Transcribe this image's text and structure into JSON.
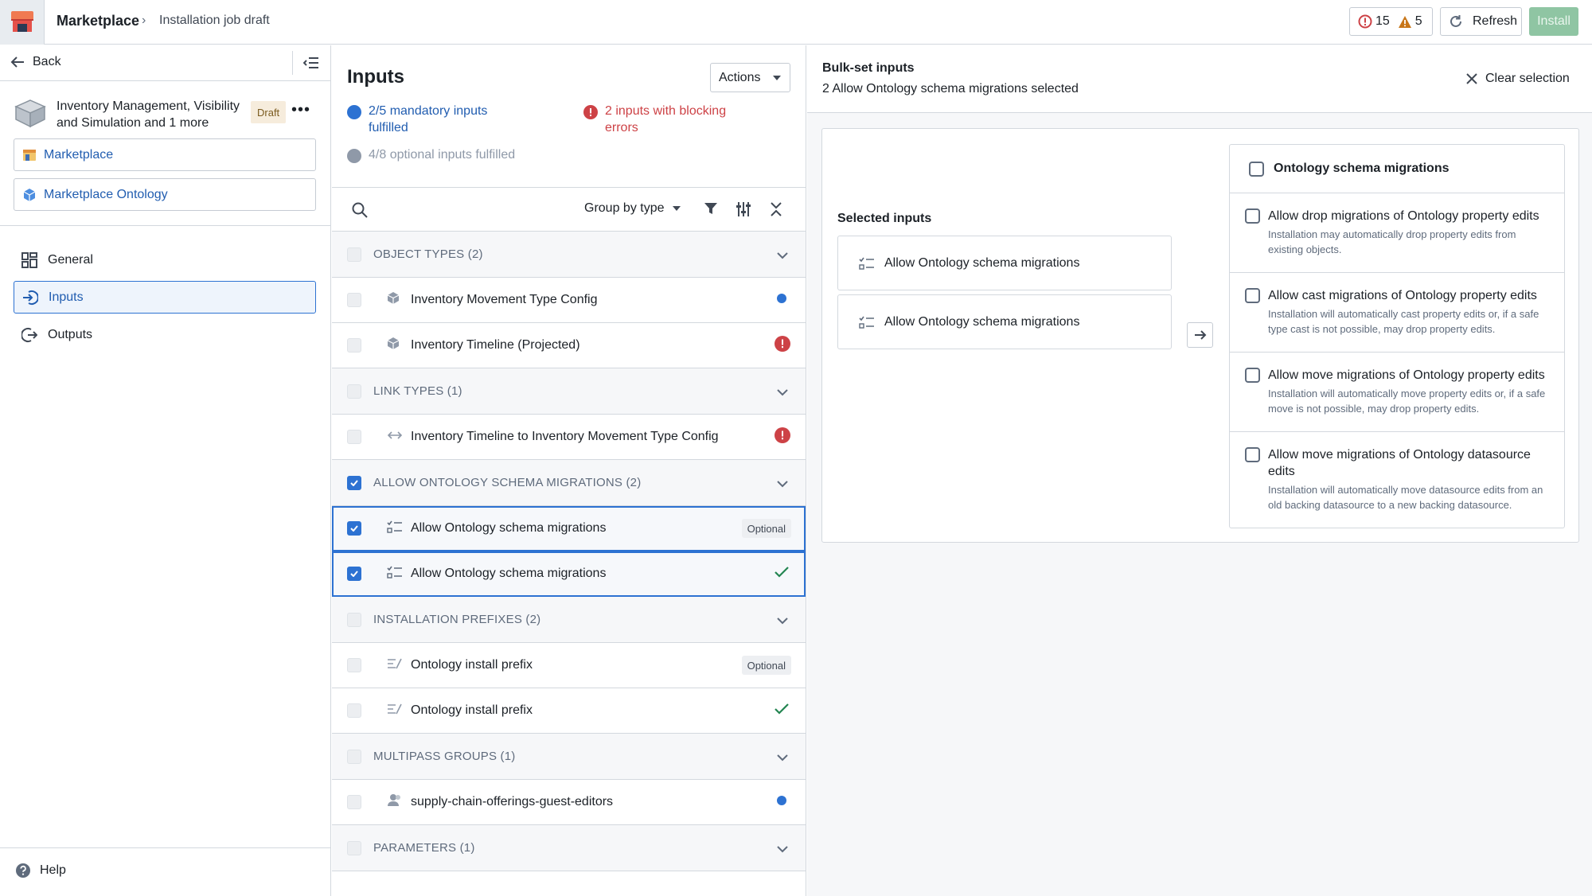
{
  "topbar": {
    "app_name": "Marketplace",
    "breadcrumb_current": "Installation job draft",
    "error_count": "15",
    "warning_count": "5",
    "refresh_label": "Refresh",
    "install_label": "Install"
  },
  "sidebar": {
    "back_label": "Back",
    "product_title": "Inventory Management, Visibility and Simulation and 1 more",
    "draft_badge": "Draft",
    "links": [
      {
        "label": "Marketplace",
        "icon": "marketplace-store-icon"
      },
      {
        "label": "Marketplace Ontology",
        "icon": "ontology-cube-icon"
      }
    ],
    "nav": [
      {
        "label": "General",
        "icon": "dashboard-grid-icon"
      },
      {
        "label": "Inputs",
        "icon": "log-in-icon",
        "active": true
      },
      {
        "label": "Outputs",
        "icon": "log-out-icon"
      }
    ],
    "help_label": "Help"
  },
  "inputs": {
    "title": "Inputs",
    "actions_label": "Actions",
    "mandatory_status": "2/5 mandatory inputs fulfilled",
    "blocking_status": "2 inputs with blocking errors",
    "optional_status": "4/8 optional inputs fulfilled",
    "group_by_label": "Group by type",
    "optional_tag": "Optional",
    "sections": [
      {
        "header": "OBJECT TYPES (2)",
        "checked": false,
        "items": [
          {
            "label": "Inventory Movement Type Config",
            "icon": "cube-icon",
            "status": "blue-dot",
            "checked": false
          },
          {
            "label": "Inventory Timeline (Projected)",
            "icon": "cube-icon",
            "status": "error",
            "checked": false
          }
        ]
      },
      {
        "header": "LINK TYPES (1)",
        "checked": false,
        "items": [
          {
            "label": "Inventory Timeline to Inventory Movement Type Config",
            "icon": "link-arrows-icon",
            "status": "error",
            "checked": false
          }
        ]
      },
      {
        "header": "ALLOW ONTOLOGY SCHEMA MIGRATIONS (2)",
        "checked": true,
        "items": [
          {
            "label": "Allow Ontology schema migrations",
            "icon": "checklist-icon",
            "status": "optional",
            "checked": true,
            "selected": true
          },
          {
            "label": "Allow Ontology schema migrations",
            "icon": "checklist-icon",
            "status": "check",
            "checked": true,
            "selected": true
          }
        ]
      },
      {
        "header": "INSTALLATION PREFIXES (2)",
        "checked": false,
        "items": [
          {
            "label": "Ontology install prefix",
            "icon": "text-prefix-icon",
            "status": "optional",
            "checked": false
          },
          {
            "label": "Ontology install prefix",
            "icon": "text-prefix-icon",
            "status": "check",
            "checked": false
          }
        ]
      },
      {
        "header": "MULTIPASS GROUPS (1)",
        "checked": false,
        "items": [
          {
            "label": "supply-chain-offerings-guest-editors",
            "icon": "people-icon",
            "status": "blue-dot",
            "checked": false
          }
        ]
      },
      {
        "header": "PARAMETERS (1)",
        "checked": false,
        "items": []
      }
    ]
  },
  "bulk": {
    "title": "Bulk-set inputs",
    "subtitle": "2 Allow Ontology schema migrations selected",
    "clear_label": "Clear selection",
    "selected_label": "Selected inputs",
    "selected_items": [
      "Allow Ontology schema migrations",
      "Allow Ontology schema migrations"
    ],
    "options_header": "Ontology schema migrations",
    "options": [
      {
        "title": "Allow drop migrations of Ontology property edits",
        "desc": "Installation may automatically drop property edits from existing objects."
      },
      {
        "title": "Allow cast migrations of Ontology property edits",
        "desc": "Installation will automatically cast property edits or, if a safe type cast is not possible, may drop property edits."
      },
      {
        "title": "Allow move migrations of Ontology property edits",
        "desc": "Installation will automatically move property edits or, if a safe move is not possible, may drop property edits."
      },
      {
        "title": "Allow move migrations of Ontology datasource edits",
        "desc": "Installation will automatically move datasource edits from an old backing datasource to a new backing datasource."
      }
    ]
  },
  "colors": {
    "primary": "#2d72d2",
    "danger": "#cd4246",
    "warning": "#c87619",
    "success": "#238551",
    "install_disabled": "#8fc5a3"
  }
}
